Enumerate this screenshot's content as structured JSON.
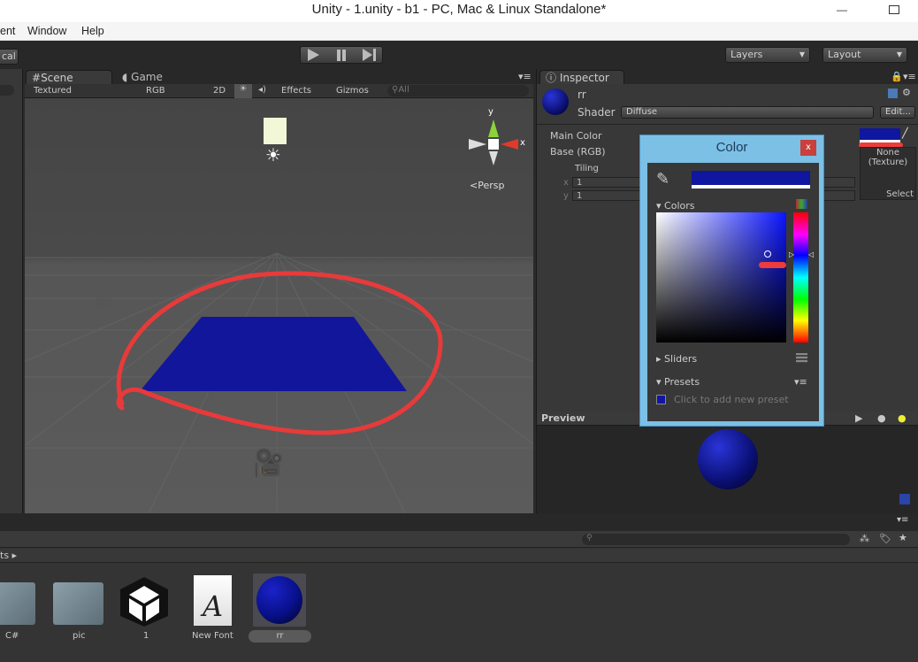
{
  "window": {
    "title": "Unity - 1.unity - b1 - PC, Mac & Linux Standalone*",
    "minimize": "—"
  },
  "menu": [
    "ent",
    "Window",
    "Help"
  ],
  "toolbar": {
    "left_button": "cal",
    "layers": "Layers",
    "layout": "Layout",
    "play_icon": "play-icon",
    "pause_icon": "pause-icon",
    "step_icon": "step-icon"
  },
  "scene": {
    "tabs": {
      "scene": "Scene",
      "game": "Game"
    },
    "render_mode": "Textured",
    "color_mode": "RGB",
    "mode_2d": "2D",
    "effects": "Effects",
    "gizmos": "Gizmos",
    "search_placeholder": "All",
    "projection": "Persp",
    "axis_y": "y",
    "axis_x": "x"
  },
  "inspector": {
    "tab": "Inspector",
    "name": "rr",
    "shader_label": "Shader",
    "shader_value": "Diffuse",
    "edit_button": "Edit...",
    "main_color": "Main Color",
    "base": "Base (RGB)",
    "tiling": "Tiling",
    "x_label": "x",
    "x_value": "1",
    "y_label": "y",
    "y_value": "1",
    "texture_none": "None\n(Texture)",
    "select": "Select",
    "color_value": "#0f16a0"
  },
  "color_picker": {
    "title": "Color",
    "close": "x",
    "colors_label": "Colors",
    "sliders_label": "Sliders",
    "presets_label": "Presets",
    "add_preset": "Click to add new preset",
    "current": "#0f16a0",
    "hue_color": "#0a14ff"
  },
  "preview": {
    "label": "Preview"
  },
  "project": {
    "breadcrumb": "ts",
    "assets": [
      {
        "name": "C#",
        "type": "folder"
      },
      {
        "name": "pic",
        "type": "folder"
      },
      {
        "name": "1",
        "type": "unity-scene"
      },
      {
        "name": "New Font",
        "type": "font"
      },
      {
        "name": "rr",
        "type": "material"
      }
    ]
  }
}
